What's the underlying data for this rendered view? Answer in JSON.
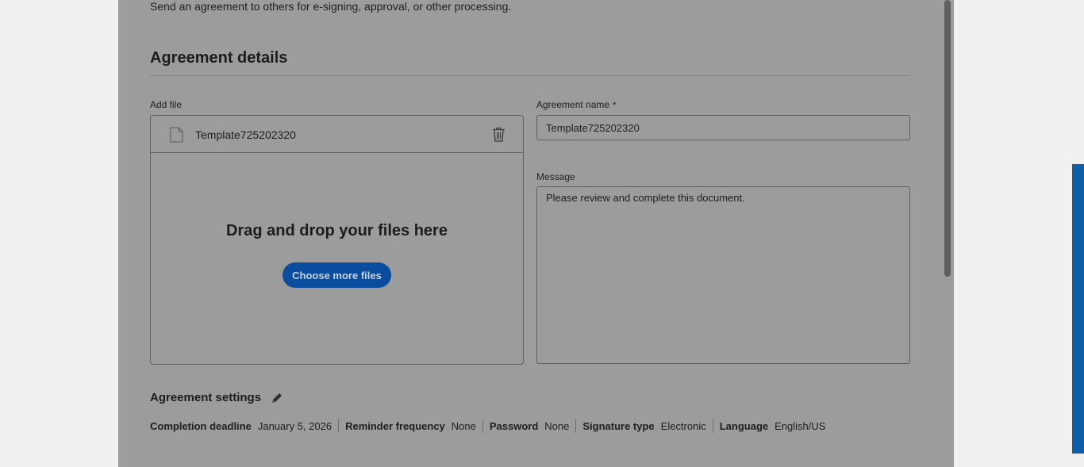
{
  "header": {
    "subtitle": "Send an agreement to others for e-signing, approval, or other processing."
  },
  "details": {
    "title": "Agreement details",
    "add_file_label": "Add file",
    "file": {
      "name": "Template725202320"
    },
    "drop_title": "Drag and drop your files here",
    "choose_button": "Choose more files",
    "agreement_name_label": "Agreement name",
    "required_mark": "*",
    "agreement_name_value": "Template725202320",
    "message_label": "Message",
    "message_value": "Please review and complete this document."
  },
  "settings": {
    "title": "Agreement settings",
    "items": [
      {
        "key": "Completion deadline",
        "value": "January 5, 2026"
      },
      {
        "key": "Reminder frequency",
        "value": "None"
      },
      {
        "key": "Password",
        "value": "None"
      },
      {
        "key": "Signature type",
        "value": "Electronic"
      },
      {
        "key": "Language",
        "value": "English/US"
      }
    ]
  },
  "icons": {
    "file": "document-icon",
    "delete": "trash-icon",
    "edit": "pencil-icon"
  },
  "colors": {
    "primary_button": "#0a4d9e",
    "overlay_page": "#9c9c9c",
    "side_strip": "#0c5fa8"
  }
}
